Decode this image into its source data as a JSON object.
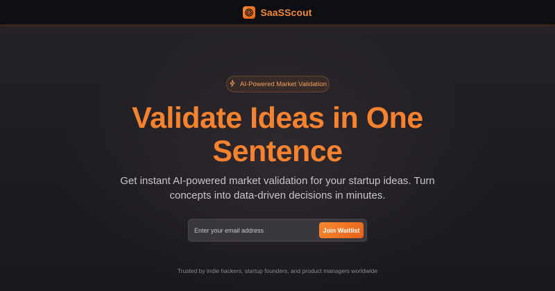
{
  "header": {
    "brand": "SaaSScout",
    "logo_icon": "target-icon"
  },
  "hero": {
    "badge": {
      "icon": "sparkle-icon",
      "label": "AI-Powered Market Validation"
    },
    "headline_line1": "Validate Ideas in One",
    "headline_line2": "Sentence",
    "subtitle_line1": "Get instant AI-powered market validation for your startup ideas. Turn",
    "subtitle_line2": "concepts into data-driven decisions in minutes."
  },
  "signup": {
    "email_placeholder": "Enter your email address",
    "email_value": "",
    "button_label": "Join Waitlist"
  },
  "footer_note": "Trusted by indie hackers, startup founders, and product managers worldwide",
  "colors": {
    "accent": "#f5822e",
    "background": "#1e1c21",
    "header_bg": "#0f0e13"
  }
}
